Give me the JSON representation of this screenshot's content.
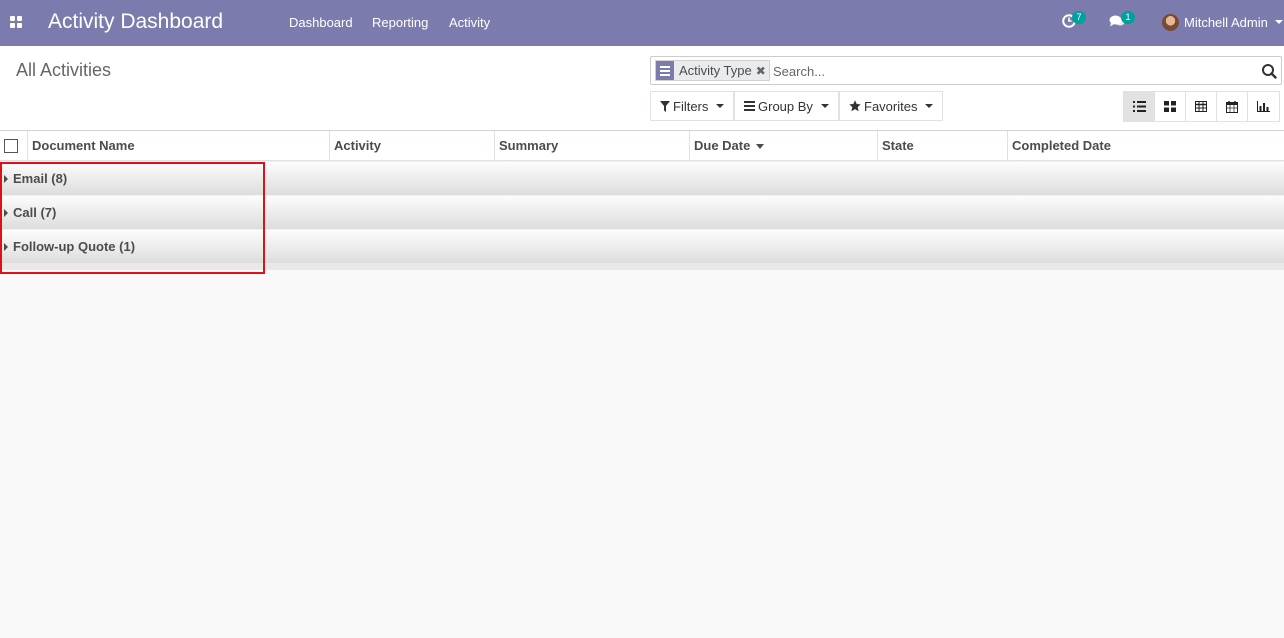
{
  "navbar": {
    "app_title": "Activity Dashboard",
    "menu": [
      "Dashboard",
      "Reporting",
      "Activity"
    ],
    "activity_badge": "7",
    "message_badge": "1",
    "user_name": "Mitchell Admin"
  },
  "control_panel": {
    "breadcrumb": "All Activities",
    "facet_label": "Activity Type",
    "search_placeholder": "Search...",
    "filters_label": "Filters",
    "group_by_label": "Group By",
    "favorites_label": "Favorites",
    "views": [
      "list-icon",
      "kanban-icon",
      "pivot-icon",
      "calendar-icon",
      "graph-icon"
    ],
    "active_view": "list-icon"
  },
  "list": {
    "columns": [
      "Document Name",
      "Activity",
      "Summary",
      "Due Date",
      "State",
      "Completed Date"
    ],
    "sorted_column": "Due Date",
    "groups": [
      "Email (8)",
      "Call (7)",
      "Follow-up Quote (1)"
    ]
  },
  "colors": {
    "brand": "#7c7bad",
    "badge": "#00a09d",
    "highlight": "#e0101b"
  }
}
